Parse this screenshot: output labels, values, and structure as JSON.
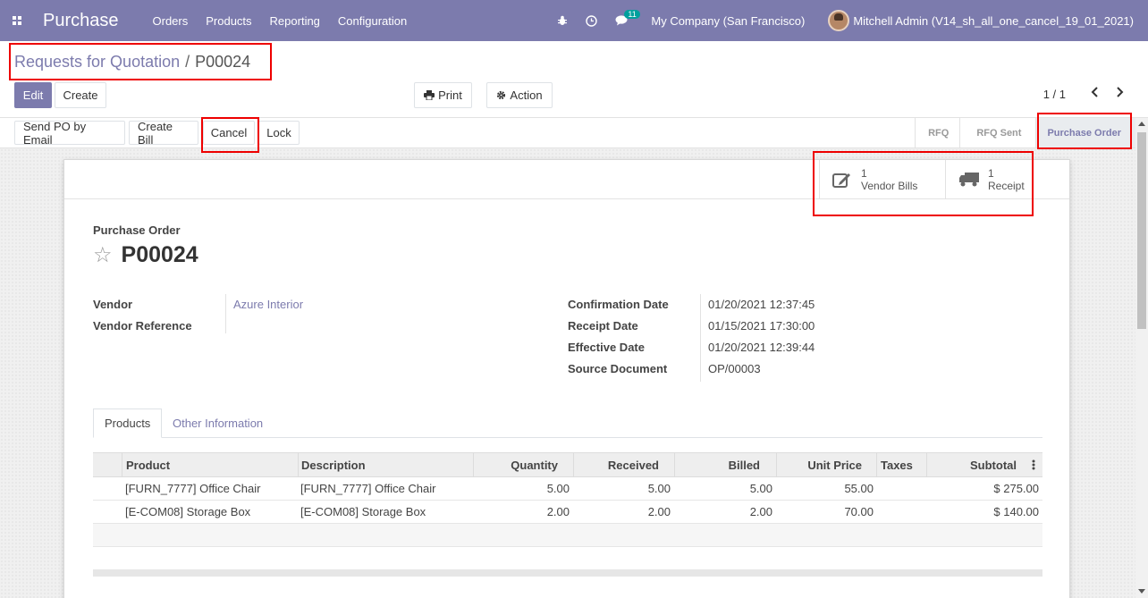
{
  "navbar": {
    "app_name": "Purchase",
    "menu": [
      "Orders",
      "Products",
      "Reporting",
      "Configuration"
    ],
    "chat_count": "11",
    "company": "My Company (San Francisco)",
    "user": "Mitchell Admin (V14_sh_all_one_cancel_19_01_2021)"
  },
  "breadcrumb": {
    "parent": "Requests for Quotation",
    "separator": "/",
    "current": "P00024"
  },
  "toolbar": {
    "edit": "Edit",
    "create": "Create",
    "print": "Print",
    "action": "Action",
    "pager": "1 / 1"
  },
  "statusbar": {
    "buttons": [
      "Send PO by Email",
      "Create Bill",
      "Cancel",
      "Lock"
    ],
    "stages": [
      "RFQ",
      "RFQ Sent",
      "Purchase Order"
    ],
    "active_stage": "Purchase Order"
  },
  "smart_buttons": [
    {
      "count": "1",
      "label": "Vendor Bills",
      "icon": "pencil-square-icon"
    },
    {
      "count": "1",
      "label": "Receipt",
      "icon": "truck-icon"
    }
  ],
  "form": {
    "title_label": "Purchase Order",
    "title": "P00024",
    "vendor_label": "Vendor",
    "vendor": "Azure Interior",
    "vendor_ref_label": "Vendor Reference",
    "confirmation_date_label": "Confirmation Date",
    "confirmation_date": "01/20/2021 12:37:45",
    "receipt_date_label": "Receipt Date",
    "receipt_date": "01/15/2021 17:30:00",
    "effective_date_label": "Effective Date",
    "effective_date": "01/20/2021 12:39:44",
    "source_document_label": "Source Document",
    "source_document": "OP/00003"
  },
  "tabs": [
    "Products",
    "Other Information"
  ],
  "order_lines": {
    "headers": [
      "Product",
      "Description",
      "Quantity",
      "Received",
      "Billed",
      "Unit Price",
      "Taxes",
      "Subtotal"
    ],
    "rows": [
      [
        "[FURN_7777] Office Chair",
        "[FURN_7777] Office Chair",
        "5.00",
        "5.00",
        "5.00",
        "55.00",
        "",
        "$ 275.00"
      ],
      [
        "[E-COM08] Storage Box",
        "[E-COM08] Storage Box",
        "2.00",
        "2.00",
        "2.00",
        "70.00",
        "",
        "$ 140.00"
      ]
    ]
  },
  "colors": {
    "brand": "#7c7bad",
    "highlight": "#e00000"
  }
}
